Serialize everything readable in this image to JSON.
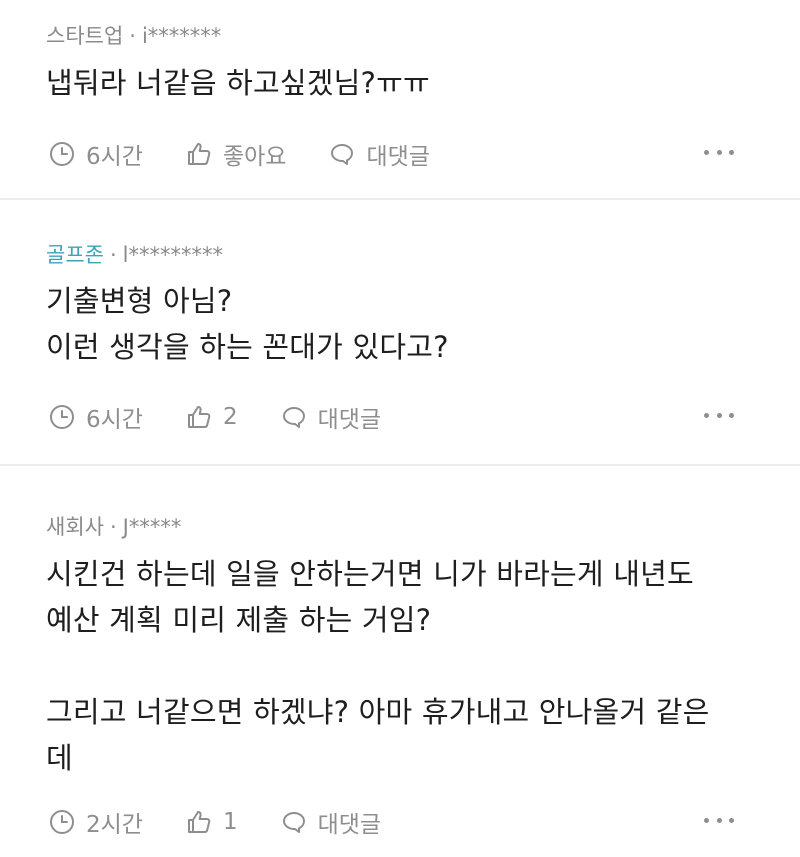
{
  "comments": [
    {
      "company": "스타트업",
      "user": "i*******",
      "lines": [
        "냅둬라 너같음 하고싶겠님?ㅠㅠ"
      ],
      "time": "6시간",
      "like_label": "좋아요",
      "reply_label": "대댓글"
    },
    {
      "company": "골프존",
      "user": "l*********",
      "lines": [
        "기출변형 아님?",
        "이런 생각을 하는 꼰대가 있다고?"
      ],
      "time": "6시간",
      "like_label": "2",
      "reply_label": "대댓글"
    },
    {
      "company": "새회사",
      "user": "J*****",
      "lines": [
        "시킨건 하는데 일을 안하는거면 니가 바라는게 내년도",
        "예산 계획 미리 제출 하는 거임?",
        "",
        "그리고 너같으면 하겠냐? 아마 휴가내고 안나올거 같은",
        "데"
      ],
      "time": "2시간",
      "like_label": "1",
      "reply_label": "대댓글"
    }
  ],
  "colors": {
    "company_link": "#3fa3b8",
    "meta_gray": "#8a8a8a",
    "divider": "#ececec"
  },
  "icons": {
    "time": "clock-icon",
    "like": "thumbs-up-icon",
    "reply": "speech-bubble-icon",
    "more": "more-horizontal-icon"
  }
}
